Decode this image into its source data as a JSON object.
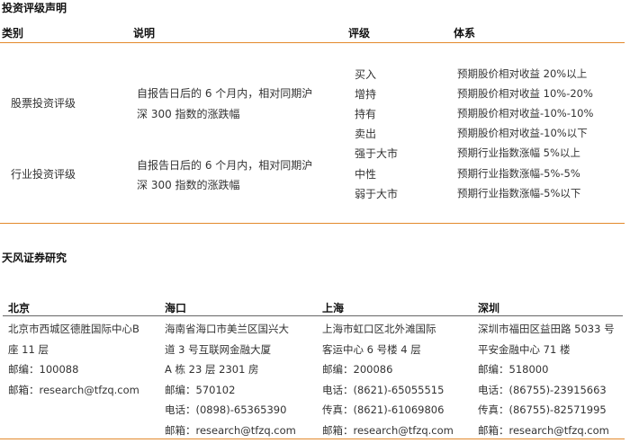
{
  "rating": {
    "title": "投资评级声明",
    "headers": [
      "类别",
      "说明",
      "评级",
      "体系"
    ],
    "categories": [
      {
        "name": "股票投资评级",
        "desc": [
          "自报告日后的 6 个月内，相对同期沪",
          "深 300 指数的涨跌幅"
        ],
        "ratings": [
          {
            "level": "买入",
            "system": "预期股价相对收益 20%以上"
          },
          {
            "level": "增持",
            "system": "预期股价相对收益 10%-20%"
          },
          {
            "level": "持有",
            "system": "预期股价相对收益-10%-10%"
          },
          {
            "level": "卖出",
            "system": "预期股价相对收益-10%以下"
          }
        ]
      },
      {
        "name": "行业投资评级",
        "desc": [
          "自报告日后的 6 个月内，相对同期沪",
          "深 300 指数的涨跌幅"
        ],
        "ratings": [
          {
            "level": "强于大市",
            "system": "预期行业指数涨幅 5%以上"
          },
          {
            "level": "中性",
            "system": "预期行业指数涨幅-5%-5%"
          },
          {
            "level": "弱于大市",
            "system": "预期行业指数涨幅-5%以下"
          }
        ]
      }
    ]
  },
  "research": {
    "title": "天风证券研究",
    "offices": [
      {
        "city": "北京",
        "lines": [
          "北京市西城区德胜国际中心B",
          "座 11 层",
          "邮编：100088",
          "邮箱：research@tfzq.com"
        ]
      },
      {
        "city": "海口",
        "lines": [
          "海南省海口市美兰区国兴大",
          "道 3 号互联网金融大厦",
          "A 栋 23 层 2301 房",
          "邮编：570102",
          "电话：(0898)-65365390",
          "邮箱：research@tfzq.com"
        ]
      },
      {
        "city": "上海",
        "lines": [
          "上海市虹口区北外滩国际",
          "客运中心 6 号楼 4 层",
          "邮编：200086",
          "电话：(8621)-65055515",
          "传真：(8621)-61069806",
          "邮箱：research@tfzq.com"
        ]
      },
      {
        "city": "深圳",
        "lines": [
          "深圳市福田区益田路 5033 号",
          "平安金融中心 71 楼",
          "邮编：518000",
          "电话：(86755)-23915663",
          "传真：(86755)-82571995",
          "邮箱：research@tfzq.com"
        ]
      }
    ]
  }
}
